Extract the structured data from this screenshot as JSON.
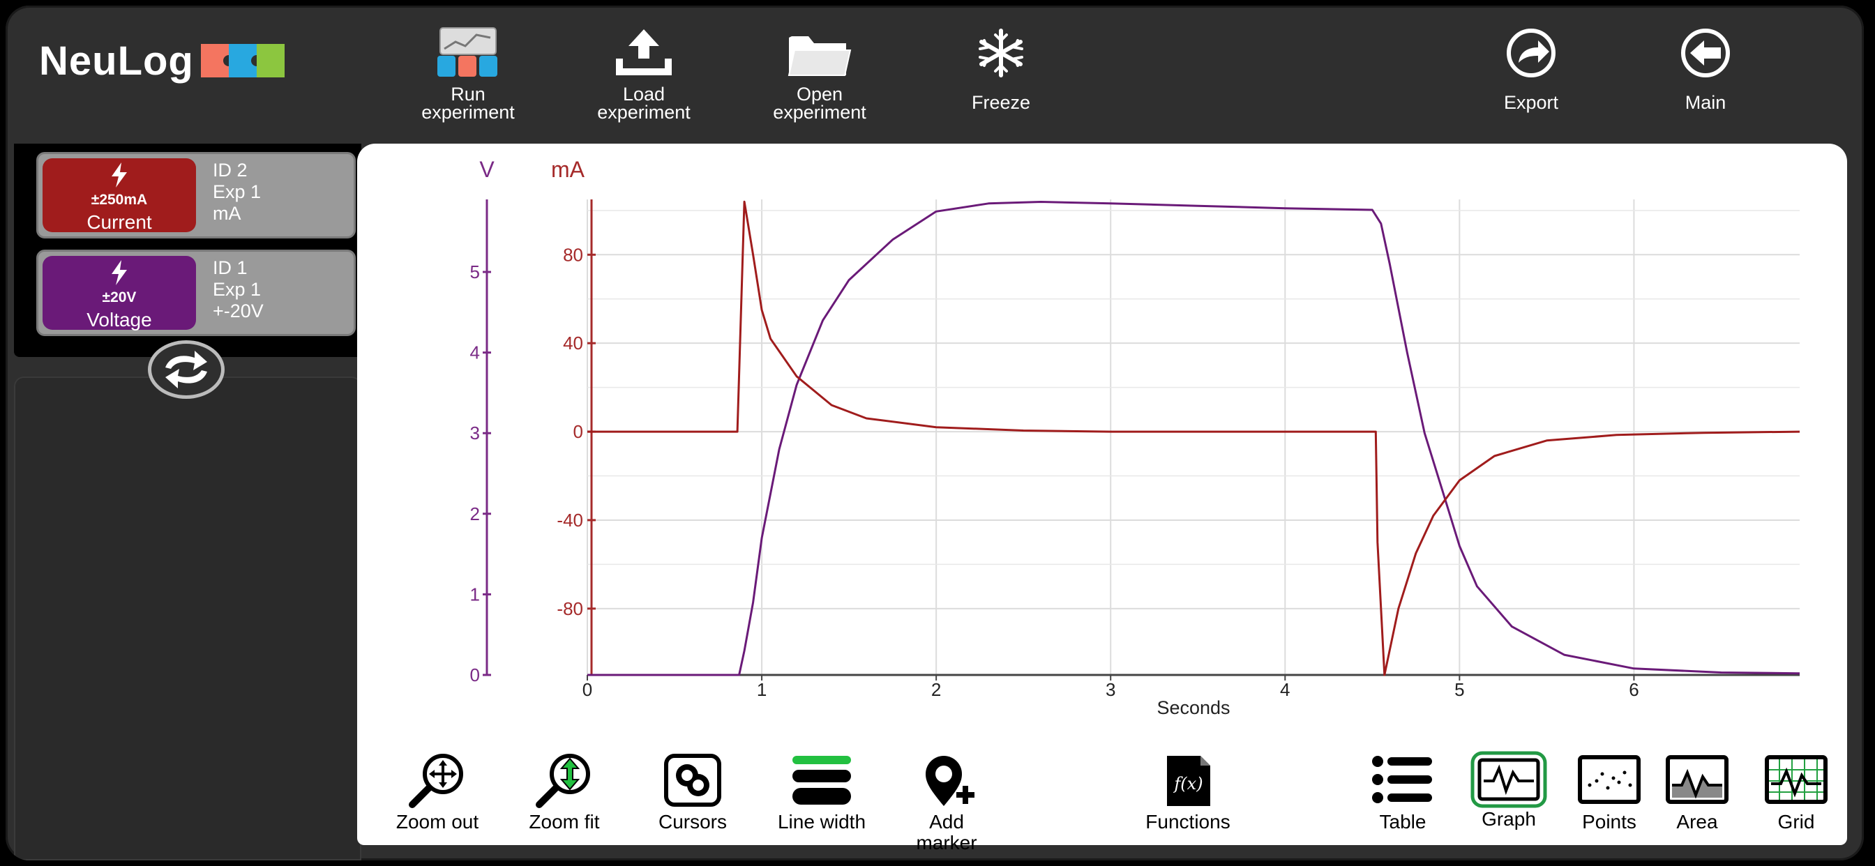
{
  "app": {
    "logo_text": "NeuLog",
    "logo_colors": [
      "#f47560",
      "#28a8e0",
      "#8cc63f"
    ]
  },
  "toolbar": {
    "run": "Run\nexperiment",
    "load": "Load\nexperiment",
    "open": "Open\nexperiment",
    "freeze": "Freeze",
    "export": "Export",
    "main": "Main"
  },
  "sensors": [
    {
      "range": "±250mA",
      "name": "Current",
      "id": "ID 2",
      "exp": "Exp 1",
      "unit": "mA",
      "color": "#a01c1c"
    },
    {
      "range": "±20V",
      "name": "Voltage",
      "id": "ID 1",
      "exp": "Exp 1",
      "unit": "+-20V",
      "color": "#6a1a78"
    }
  ],
  "chart_data": {
    "type": "line",
    "xlabel": "Seconds",
    "xlim": [
      0,
      6.95
    ],
    "x_ticks": [
      "0",
      "1",
      "2",
      "3",
      "4",
      "5",
      "6"
    ],
    "left_axes": [
      {
        "unit_label": "V",
        "color": "#7a2a86",
        "ylim": [
          0,
          5.9
        ],
        "ticks": [
          "0",
          "1",
          "2",
          "3",
          "4",
          "5"
        ]
      },
      {
        "unit_label": "mA",
        "color": "#a52a2a",
        "ylim": [
          -110,
          105
        ],
        "ticks": [
          "-80",
          "-40",
          "0",
          "40",
          "80"
        ]
      }
    ],
    "series": [
      {
        "axis": "V",
        "color": "#6a1a78",
        "points": [
          [
            0,
            0
          ],
          [
            0.87,
            0
          ],
          [
            0.9,
            0.3
          ],
          [
            0.95,
            0.9
          ],
          [
            1.0,
            1.7
          ],
          [
            1.1,
            2.8
          ],
          [
            1.2,
            3.6
          ],
          [
            1.35,
            4.4
          ],
          [
            1.5,
            4.9
          ],
          [
            1.75,
            5.4
          ],
          [
            2.0,
            5.75
          ],
          [
            2.3,
            5.85
          ],
          [
            2.6,
            5.87
          ],
          [
            3.0,
            5.85
          ],
          [
            3.5,
            5.82
          ],
          [
            4.0,
            5.79
          ],
          [
            4.5,
            5.77
          ],
          [
            4.55,
            5.6
          ],
          [
            4.6,
            5.1
          ],
          [
            4.7,
            4.0
          ],
          [
            4.8,
            3.0
          ],
          [
            4.9,
            2.3
          ],
          [
            5.0,
            1.6
          ],
          [
            5.1,
            1.1
          ],
          [
            5.3,
            0.6
          ],
          [
            5.6,
            0.25
          ],
          [
            6.0,
            0.08
          ],
          [
            6.5,
            0.03
          ],
          [
            6.95,
            0.02
          ]
        ]
      },
      {
        "axis": "mA",
        "color": "#a01c1c",
        "points": [
          [
            0,
            0
          ],
          [
            0.86,
            0
          ],
          [
            0.9,
            104
          ],
          [
            0.95,
            80
          ],
          [
            1.0,
            55
          ],
          [
            1.05,
            42
          ],
          [
            1.2,
            25
          ],
          [
            1.4,
            12
          ],
          [
            1.6,
            6
          ],
          [
            2.0,
            2
          ],
          [
            2.5,
            0.5
          ],
          [
            3.0,
            0
          ],
          [
            4.52,
            0
          ],
          [
            4.53,
            -50
          ],
          [
            4.57,
            -110
          ],
          [
            4.65,
            -80
          ],
          [
            4.75,
            -55
          ],
          [
            4.85,
            -38
          ],
          [
            5.0,
            -22
          ],
          [
            5.2,
            -11
          ],
          [
            5.5,
            -4
          ],
          [
            5.9,
            -1.5
          ],
          [
            6.4,
            -0.5
          ],
          [
            6.95,
            0
          ]
        ]
      }
    ]
  },
  "bottom_toolbar": {
    "zoom_out": "Zoom out",
    "zoom_fit": "Zoom fit",
    "cursors": "Cursors",
    "line_width": "Line width",
    "add_marker": "Add\nmarker",
    "functions": "Functions",
    "functions_glyph": "f(x)",
    "table": "Table",
    "graph": "Graph",
    "points": "Points",
    "area": "Area",
    "grid": "Grid"
  }
}
